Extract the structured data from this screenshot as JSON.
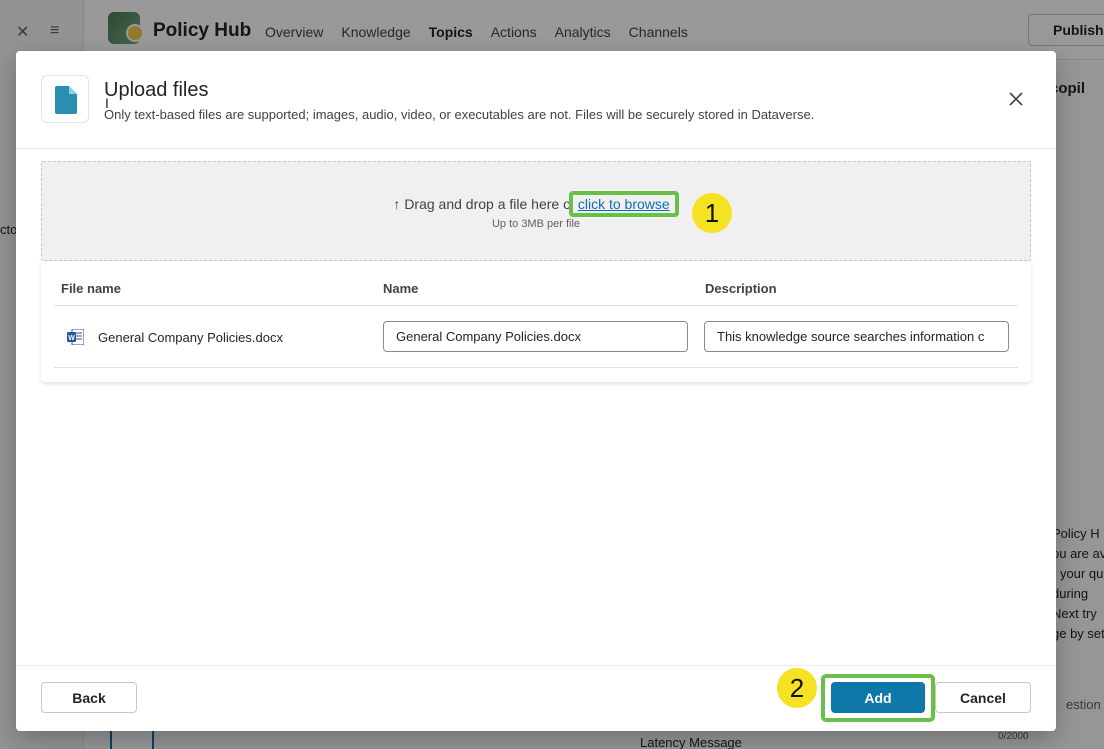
{
  "app": {
    "title": "Policy Hub",
    "nav": [
      "Overview",
      "Knowledge",
      "Topics",
      "Actions",
      "Analytics",
      "Channels"
    ],
    "active_nav": "Topics",
    "publish_label": "Publish",
    "bg_left_fragment": "ctor",
    "bg_right_title": "r copil",
    "bg_right_lines": [
      "Policy H",
      "ou are av",
      "r your qu",
      "during",
      "Next try",
      "ge by set"
    ],
    "bg_input_fragment": "estion or",
    "bg_counter": "0/2000",
    "bg_latency": "Latency Message"
  },
  "dialog": {
    "title": "Upload files",
    "subtitle": "Only text-based files are supported; images, audio, video, or executables are not. Files will be securely stored in Dataverse.",
    "dropzone": {
      "text": "Drag and drop a file here o",
      "browse_link": "click to browse",
      "limit": "Up to 3MB per file"
    },
    "table": {
      "headers": {
        "file_name": "File name",
        "name": "Name",
        "description": "Description"
      },
      "rows": [
        {
          "file_name": "General Company Policies.docx",
          "name": "General Company Policies.docx",
          "description": "This knowledge source searches information c"
        }
      ]
    },
    "footer": {
      "back": "Back",
      "add": "Add",
      "cancel": "Cancel"
    }
  },
  "annotations": {
    "step1": "1",
    "step2": "2",
    "highlight_color": "#6abf4b",
    "badge_color": "#f5e223"
  },
  "colors": {
    "primary": "#0e78a8",
    "link": "#0f6cbd",
    "file_icon": "#2a8fb0"
  }
}
